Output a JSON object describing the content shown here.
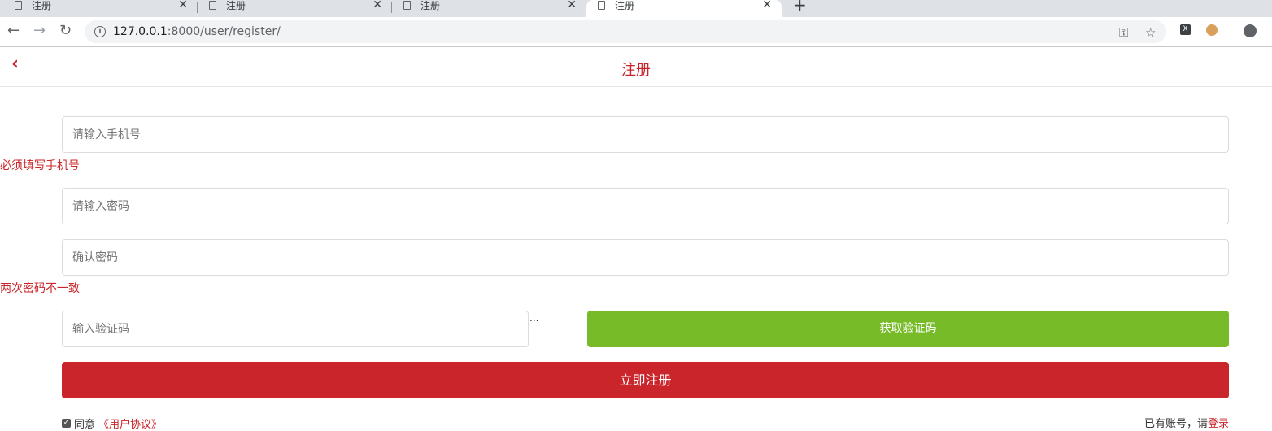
{
  "browser": {
    "tabs": [
      {
        "title": "注册",
        "active": false
      },
      {
        "title": "注册",
        "active": false
      },
      {
        "title": "注册",
        "active": false
      },
      {
        "title": "注册",
        "active": true
      }
    ],
    "close_glyph": "✕",
    "new_tab_glyph": "+",
    "url_host": "127.0.0.1",
    "url_rest": ":8000/user/register/",
    "icons": [
      "back-arrow-icon",
      "forward-arrow-icon",
      "reload-icon",
      "info-icon",
      "key-icon",
      "star-icon",
      "extension-x-icon",
      "cookie-icon",
      "profile-icon"
    ]
  },
  "header": {
    "back_glyph": "‹",
    "title": "注册"
  },
  "form": {
    "phone_placeholder": "请输入手机号",
    "phone_error": "必须填写手机号",
    "password_placeholder": "请输入密码",
    "confirm_placeholder": "确认密码",
    "confirm_error": "两次密码不一致",
    "code_placeholder": "输入验证码",
    "code_ellipsis": "...",
    "get_code_label": "获取验证码",
    "register_label": "立即注册",
    "agree_text": "同意",
    "agreement_link": "《用户协议》",
    "have_account_text": "已有账号，请",
    "login_link": "登录"
  },
  "colors": {
    "brand_red": "#c9252a",
    "code_button_green": "#77bc28"
  }
}
